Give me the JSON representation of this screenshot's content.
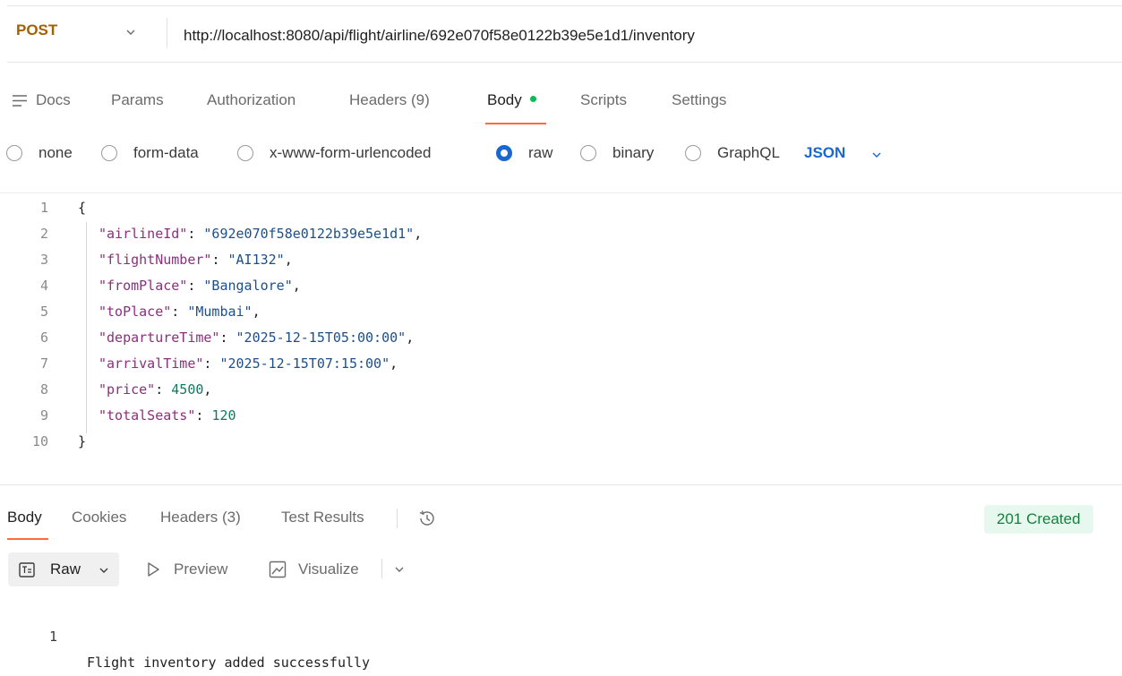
{
  "request": {
    "method": "POST",
    "url": "http://localhost:8080/api/flight/airline/692e070f58e0122b39e5e1d1/inventory"
  },
  "request_tabs": {
    "docs": "Docs",
    "params": "Params",
    "authorization": "Authorization",
    "headers": "Headers (9)",
    "body": "Body",
    "scripts": "Scripts",
    "settings": "Settings"
  },
  "body_types": {
    "none": "none",
    "form_data": "form-data",
    "urlencoded": "x-www-form-urlencoded",
    "raw": "raw",
    "binary": "binary",
    "graphql": "GraphQL",
    "selected": "raw",
    "language": "JSON"
  },
  "editor": {
    "line_numbers": [
      "1",
      "2",
      "3",
      "4",
      "5",
      "6",
      "7",
      "8",
      "9",
      "10"
    ],
    "open_brace": "{",
    "close_brace": "}",
    "fields": [
      {
        "key": "\"airlineId\"",
        "value": "\"692e070f58e0122b39e5e1d1\"",
        "type": "string",
        "comma": ","
      },
      {
        "key": "\"flightNumber\"",
        "value": "\"AI132\"",
        "type": "string",
        "comma": ","
      },
      {
        "key": "\"fromPlace\"",
        "value": "\"Bangalore\"",
        "type": "string",
        "comma": ","
      },
      {
        "key": "\"toPlace\"",
        "value": "\"Mumbai\"",
        "type": "string",
        "comma": ","
      },
      {
        "key": "\"departureTime\"",
        "value": "\"2025-12-15T05:00:00\"",
        "type": "string",
        "comma": ","
      },
      {
        "key": "\"arrivalTime\"",
        "value": "\"2025-12-15T07:15:00\"",
        "type": "string",
        "comma": ","
      },
      {
        "key": "\"price\"",
        "value": "4500",
        "type": "number",
        "comma": ","
      },
      {
        "key": "\"totalSeats\"",
        "value": "120",
        "type": "number",
        "comma": ""
      }
    ]
  },
  "response": {
    "tabs": {
      "body": "Body",
      "cookies": "Cookies",
      "headers": "Headers (3)",
      "test_results": "Test Results"
    },
    "status": "201 Created",
    "view_mode": "Raw",
    "preview": "Preview",
    "visualize": "Visualize",
    "line_number": "1",
    "content": "Flight inventory added successfully"
  },
  "colors": {
    "method": "#a16207",
    "active_tab_underline": "#ff6c37",
    "accent_blue": "#1a67d2",
    "status_bg": "#e7f8ee",
    "status_text": "#15803d"
  }
}
